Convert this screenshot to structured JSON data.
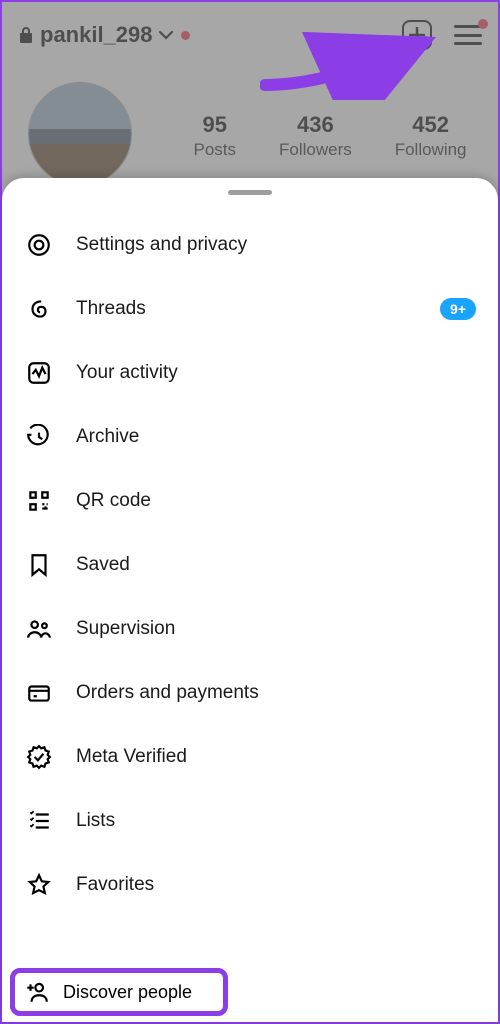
{
  "header": {
    "username": "pankil_298"
  },
  "stats": {
    "posts": {
      "count": "95",
      "label": "Posts"
    },
    "followers": {
      "count": "436",
      "label": "Followers"
    },
    "following": {
      "count": "452",
      "label": "Following"
    }
  },
  "menu": [
    {
      "label": "Settings and privacy"
    },
    {
      "label": "Threads",
      "badge": "9+"
    },
    {
      "label": "Your activity"
    },
    {
      "label": "Archive"
    },
    {
      "label": "QR code"
    },
    {
      "label": "Saved"
    },
    {
      "label": "Supervision"
    },
    {
      "label": "Orders and payments"
    },
    {
      "label": "Meta Verified"
    },
    {
      "label": "Lists"
    },
    {
      "label": "Favorites"
    },
    {
      "label": "Discover people"
    }
  ]
}
